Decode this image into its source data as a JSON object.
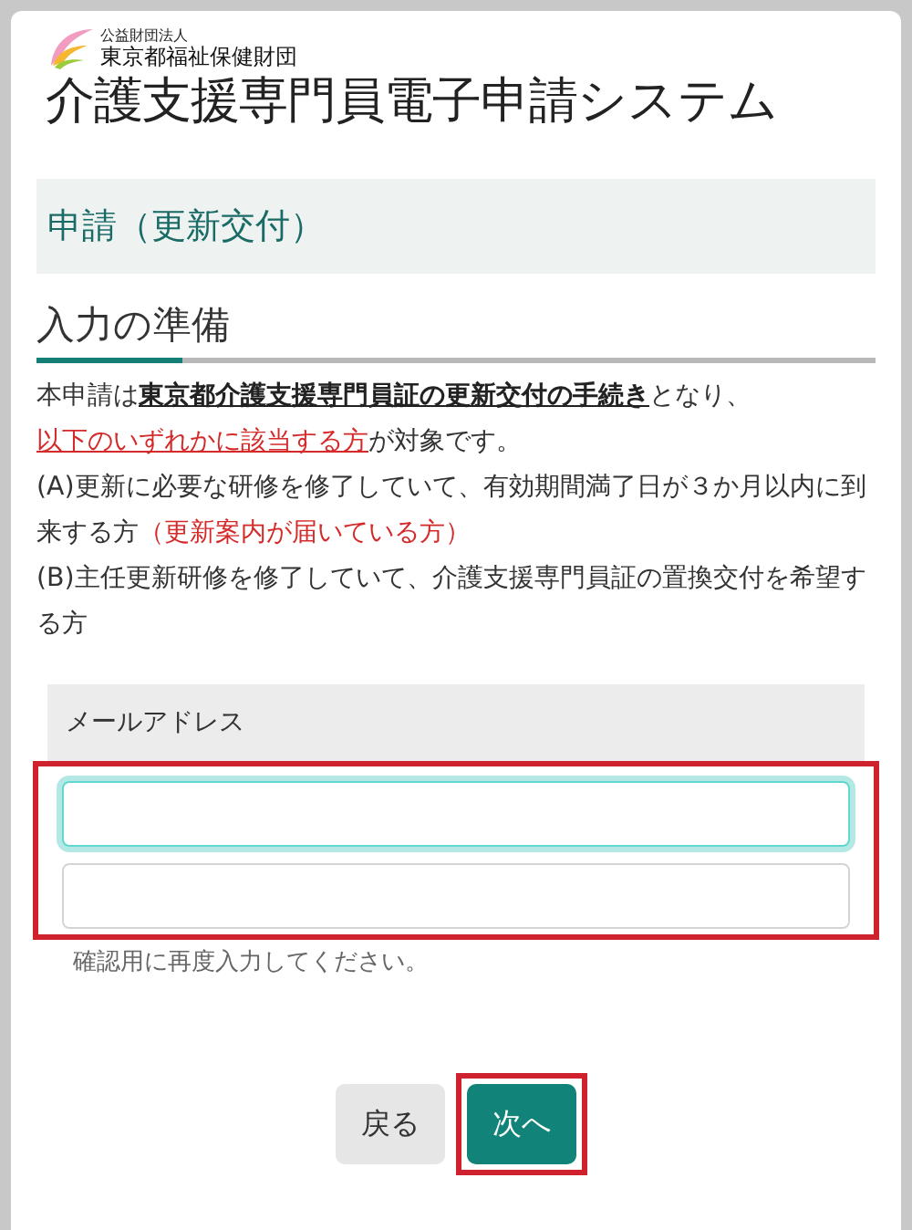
{
  "header": {
    "org_subtitle": "公益財団法人",
    "org_name": "東京都福祉保健財団",
    "system_title": "介護支援専門員電子申請システム"
  },
  "section_title": "申請（更新交付）",
  "step_heading": "入力の準備",
  "paragraphs": [
    [
      {
        "kind": "plain",
        "text": "本申請は"
      },
      {
        "kind": "emphasis",
        "text": "東京都介護支援専門員証の更新交付の手続き"
      },
      {
        "kind": "plain",
        "text": "となり、"
      },
      {
        "kind": "link",
        "text": "以下のいずれかに該当する方"
      },
      {
        "kind": "plain",
        "text": "が対象です。"
      }
    ],
    [
      {
        "kind": "plain",
        "text": "(A)更新に必要な研修を修了していて、有効期間満了日が３か月以内に到来する方"
      },
      {
        "kind": "note",
        "text": "（更新案内が届いている方）"
      }
    ],
    [
      {
        "kind": "plain",
        "text": "(B)主任更新研修を修了していて、介護支援専門員証の置換交付を希望する方"
      }
    ]
  ],
  "email": {
    "label": "メールアドレス",
    "highlighted": true,
    "fields": [
      {
        "focused": true
      },
      {
        "focused": false
      }
    ],
    "hint": "確認用に再度入力してください。"
  },
  "buttons": [
    {
      "kind": "secondary",
      "label": "戻る",
      "highlighted": false
    },
    {
      "kind": "primary",
      "label": "次へ",
      "highlighted": true
    }
  ]
}
